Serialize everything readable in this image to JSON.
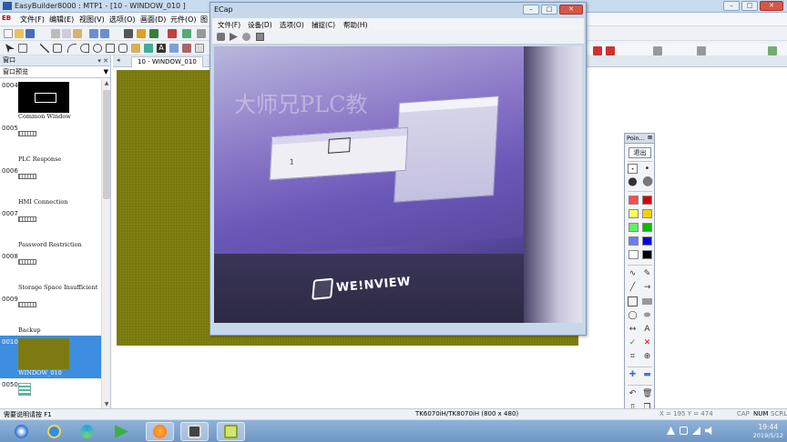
{
  "app": {
    "logo_text": "EB",
    "title": "EasyBuilder8000 : MTP1 - [10 - WINDOW_010 ]"
  },
  "menu": [
    "文件(F)",
    "编辑(E)",
    "视图(V)",
    "选项(O)",
    "画面(D)",
    "元件(O)",
    "图"
  ],
  "panel": {
    "title": "窗口",
    "dropdown": "窗口预览",
    "windows": [
      {
        "num": "0004",
        "name": "Common Window",
        "thumb": "black"
      },
      {
        "num": "0005",
        "name": "PLC Response",
        "thumb": "mini"
      },
      {
        "num": "0006",
        "name": "HMI Connection",
        "thumb": "mini"
      },
      {
        "num": "0007",
        "name": "Password Restriction",
        "thumb": "mini"
      },
      {
        "num": "0008",
        "name": "Storage Space Insufficient",
        "thumb": "mini"
      },
      {
        "num": "0009",
        "name": "Backup",
        "thumb": "mini"
      },
      {
        "num": "0010",
        "name": "WINDOW_010",
        "thumb": "selected"
      },
      {
        "num": "0050",
        "name": "",
        "thumb": "pixel"
      }
    ]
  },
  "doc_tab": "10 - WINDOW_010",
  "ecap": {
    "title": "ECap",
    "menu": [
      "文件(F)",
      "设备(D)",
      "选项(O)",
      "捕捉(C)",
      "帮助(H)"
    ],
    "watermark": "大师兄PLC教",
    "logo_text": "WE!NVIEW",
    "glyph": "1"
  },
  "palette": {
    "title": "Poin...",
    "exit_label": "退出",
    "swatches": [
      "#ff4d4d",
      "#d40000",
      "#ffff66",
      "#ffd000",
      "#66ee66",
      "#00bb00",
      "#6b7cff",
      "#0000dd",
      "#ffffff",
      "#000000"
    ],
    "text_tool": "A",
    "check": "✓",
    "cross": "✕"
  },
  "status": {
    "help": "需要说明请按 F1",
    "model": "TK6070iH/TK8070iH (800 x 480)",
    "coords": "X = 195   Y = 474",
    "cap": "CAP",
    "num": "NUM",
    "scrl": "SCRL"
  },
  "tray": {
    "time": "19:44",
    "date": "2019/5/12"
  },
  "taskbar_icons": [
    "ie",
    "app360",
    "media",
    "orange",
    "camera",
    "ecap"
  ]
}
